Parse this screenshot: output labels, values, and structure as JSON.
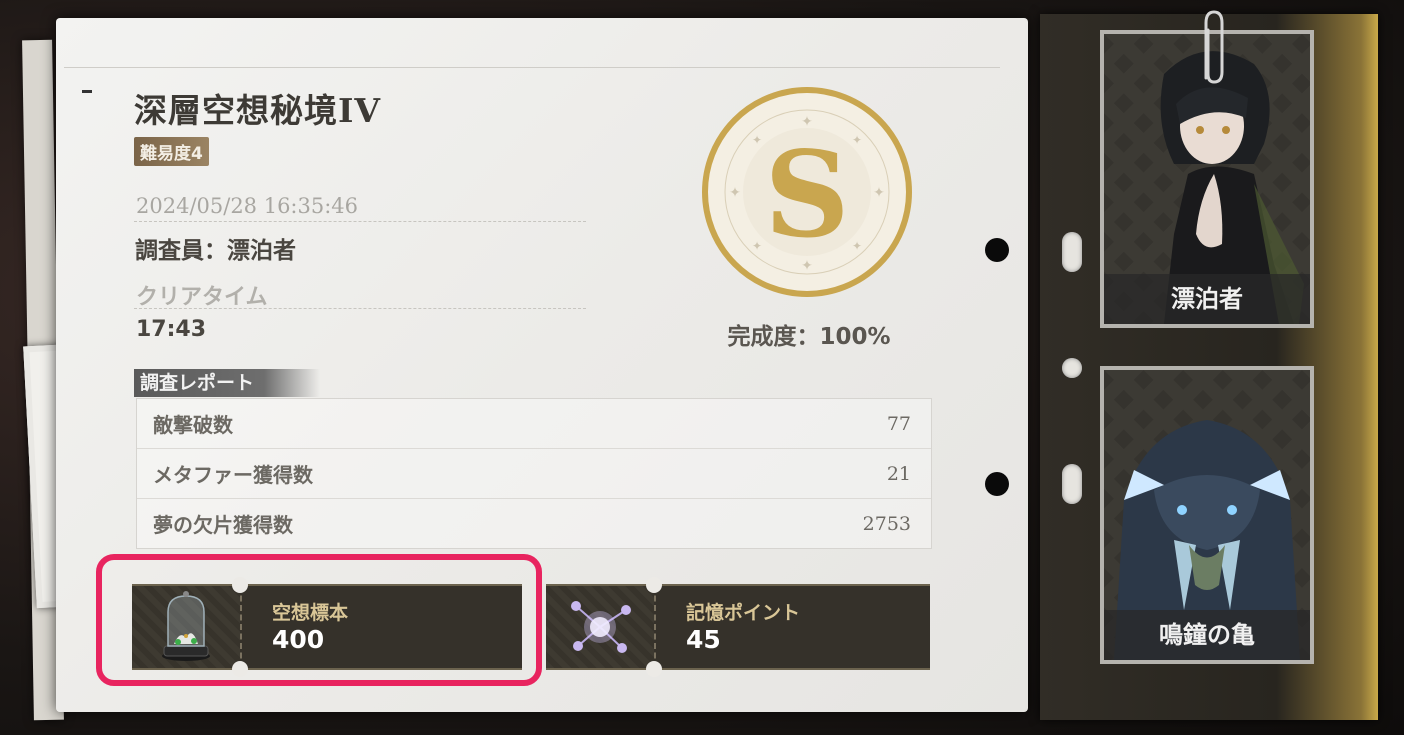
{
  "record": {
    "title": "深層空想秘境IV",
    "difficulty": "難易度4",
    "date": "2024/05/28 16:35:46",
    "investigator": "調査員：漂泊者",
    "clear_time_label": "クリアタイム",
    "clear_time": "17:43",
    "rank": "S",
    "completion": "完成度：100%"
  },
  "report": {
    "header": "調査レポート",
    "rows": [
      {
        "label": "敵撃破数",
        "value": "77"
      },
      {
        "label": "メタファー獲得数",
        "value": "21"
      },
      {
        "label": "夢の欠片獲得数",
        "value": "2753"
      }
    ]
  },
  "rewards": [
    {
      "label": "空想標本",
      "value": "400",
      "icon": "specimen-jar-icon"
    },
    {
      "label": "記憶ポイント",
      "value": "45",
      "icon": "memory-crystal-icon"
    }
  ],
  "portraits": [
    {
      "name": "漂泊者"
    },
    {
      "name": "鳴鐘の亀"
    }
  ],
  "colors": {
    "highlight": "#e8245f",
    "accent_gold": "#c9a64f",
    "reward_label": "#d9c697"
  }
}
